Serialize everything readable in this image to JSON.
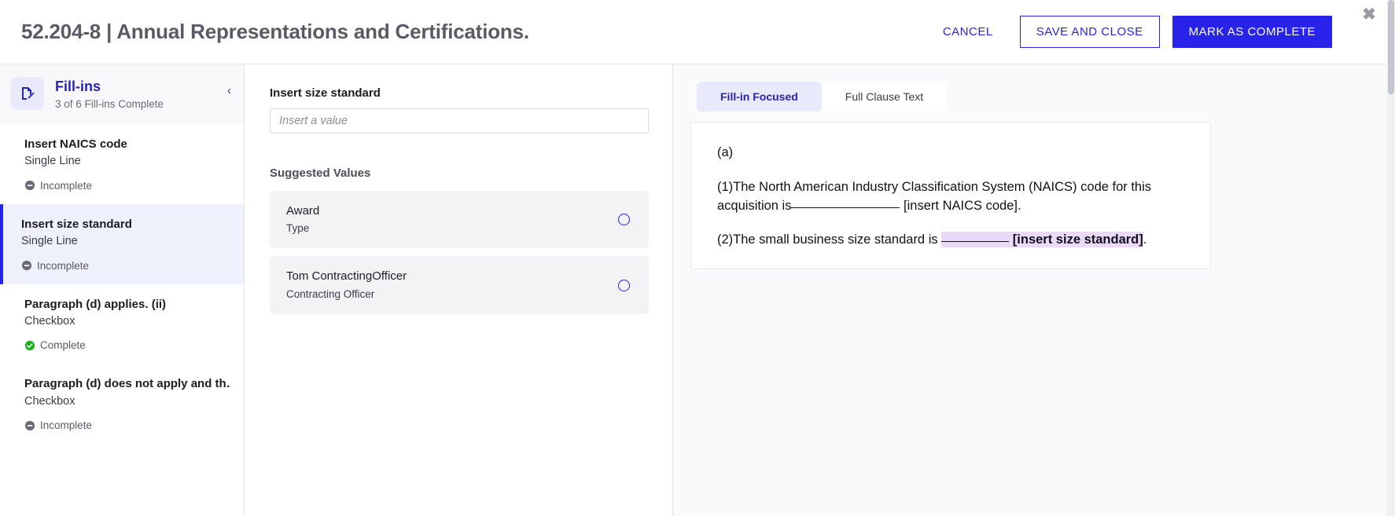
{
  "header": {
    "title": "52.204-8 | Annual Representations and Certifications.",
    "cancel_label": "CANCEL",
    "save_label": "SAVE AND CLOSE",
    "complete_label": "MARK AS COMPLETE",
    "close_label": "✖",
    "accent_color": "#2723e8"
  },
  "sidebar": {
    "heading": "Fill-ins",
    "progress": "3 of 6 Fill-ins Complete",
    "collapse_label": "‹",
    "items": [
      {
        "title": "Insert NAICS code",
        "type": "Single Line",
        "status": "Incomplete",
        "status_state": "incomplete",
        "active": false
      },
      {
        "title": "Insert size standard",
        "type": "Single Line",
        "status": "Incomplete",
        "status_state": "incomplete",
        "active": true
      },
      {
        "title": "Paragraph (d) applies. (ii)",
        "type": "Checkbox",
        "status": "Complete",
        "status_state": "complete",
        "active": false
      },
      {
        "title": "Paragraph (d) does not apply and th…",
        "type": "Checkbox",
        "status": "Incomplete",
        "status_state": "incomplete",
        "active": false
      }
    ],
    "status_colors": {
      "complete": "#1eb11e",
      "incomplete": "#6b6b78"
    }
  },
  "middle": {
    "field_label": "Insert size standard",
    "field_value": "",
    "field_placeholder": "Insert a value",
    "suggested_title": "Suggested Values",
    "suggestions": [
      {
        "name": "Award",
        "subtitle": "Type",
        "selected": false
      },
      {
        "name": "Tom ContractingOfficer",
        "subtitle": "Contracting Officer",
        "selected": false
      }
    ]
  },
  "right": {
    "tabs": [
      {
        "label": "Fill-in Focused",
        "active": true
      },
      {
        "label": "Full Clause Text",
        "active": false
      }
    ],
    "clause": {
      "para_a": "(a)",
      "para_1_before": "(1)The North American Industry Classification System (NAICS) code for this acquisition is",
      "para_1_after": " [insert NAICS code].",
      "para_2_before": "(2)The small business size standard is ",
      "para_2_fill_label": "[insert size standard]",
      "para_2_after": ".",
      "highlight_color": "#ead9f7"
    }
  }
}
